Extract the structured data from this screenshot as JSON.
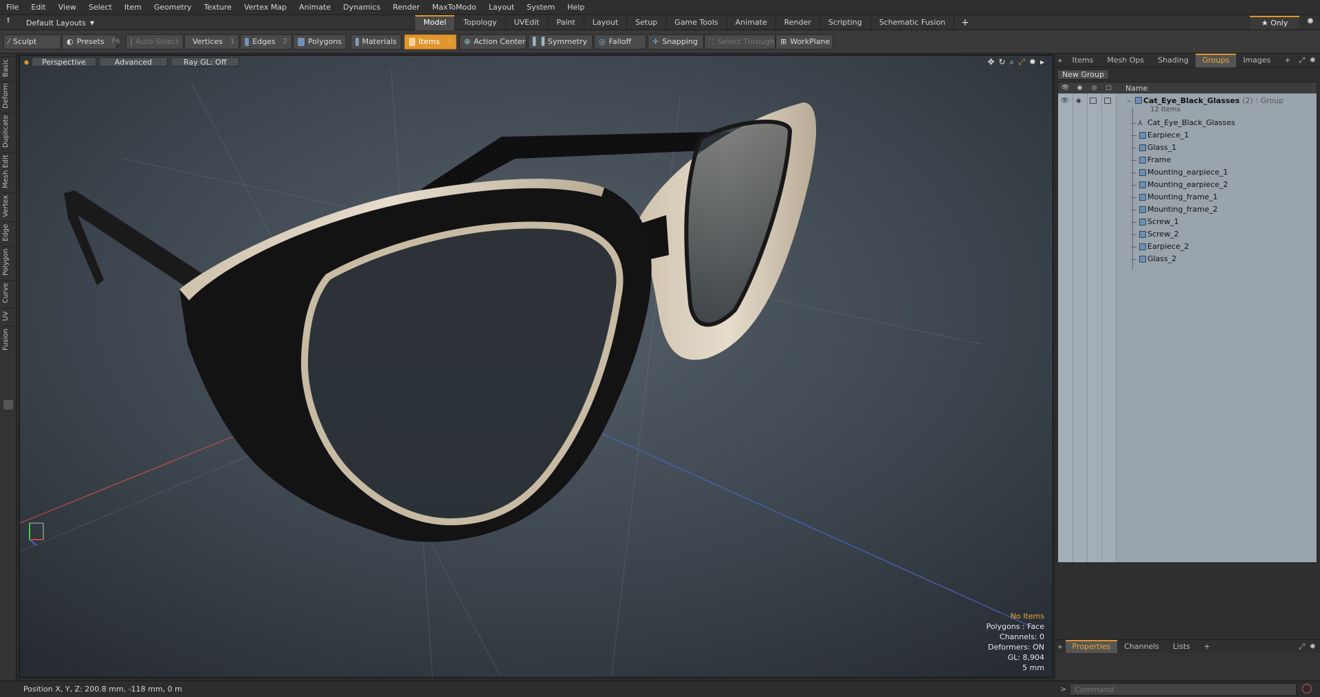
{
  "menu": [
    "File",
    "Edit",
    "View",
    "Select",
    "Item",
    "Geometry",
    "Texture",
    "Vertex Map",
    "Animate",
    "Dynamics",
    "Render",
    "MaxToModo",
    "Layout",
    "System",
    "Help"
  ],
  "layout_selector": "Default Layouts",
  "tabs": [
    {
      "label": "Model",
      "active": true
    },
    {
      "label": "Topology"
    },
    {
      "label": "UVEdit"
    },
    {
      "label": "Paint"
    },
    {
      "label": "Layout"
    },
    {
      "label": "Setup"
    },
    {
      "label": "Game Tools"
    },
    {
      "label": "Animate"
    },
    {
      "label": "Render"
    },
    {
      "label": "Scripting"
    },
    {
      "label": "Schematic Fusion"
    }
  ],
  "tab_plus": "+",
  "only_label": "★  Only",
  "toolbar": {
    "sculpt": "Sculpt",
    "presets": "Presets",
    "presets_key": "F6",
    "auto_select": "Auto Select",
    "vertices": "Vertices",
    "vertices_key": "1",
    "edges": "Edges",
    "edges_key": "2",
    "polygons": "Polygons",
    "materials": "Materials",
    "items": "Items",
    "items_key": "5",
    "action_center": "Action Center",
    "symmetry": "Symmetry",
    "falloff": "Falloff",
    "snapping": "Snapping",
    "select_through": "Select Through",
    "workplane": "WorkPlane"
  },
  "left_tabs": [
    "Basic",
    "Deform",
    "Duplicate",
    "Mesh Edit",
    "Vertex",
    "Edge",
    "Polygon",
    "Curve",
    "UV",
    "Fusion"
  ],
  "viewport": {
    "view": "Perspective",
    "advanced": "Advanced",
    "raygl": "Ray GL: Off",
    "info": {
      "no_items": "No Items",
      "polygons": "Polygons : Face",
      "channels": "Channels: 0",
      "deformers": "Deformers: ON",
      "gl": "GL: 8,904",
      "scale": "5 mm"
    }
  },
  "status": {
    "position": "Position X, Y, Z:   200.8 mm, -118 mm, 0 m",
    "command_placeholder": "Command"
  },
  "right_tabs": [
    {
      "label": "Items"
    },
    {
      "label": "Mesh Ops"
    },
    {
      "label": "Shading"
    },
    {
      "label": "Groups",
      "active": true
    },
    {
      "label": "Images"
    },
    {
      "label": "+"
    }
  ],
  "groups": {
    "new_group": "New Group",
    "name_col": "Name",
    "group_name": "Cat_Eye_Black_Glasses",
    "group_count": "(2)",
    "group_type": ": Group",
    "group_items": "12 Items",
    "items": [
      "Cat_Eye_Black_Glasses",
      "Earpiece_1",
      "Glass_1",
      "Frame",
      "Mounting_earpiece_1",
      "Mounting_earpiece_2",
      "Mounting_frame_1",
      "Mounting_frame_2",
      "Screw_1",
      "Screw_2",
      "Earpiece_2",
      "Glass_2"
    ]
  },
  "prop_tabs": [
    {
      "label": "Properties",
      "active": true
    },
    {
      "label": "Channels"
    },
    {
      "label": "Lists"
    },
    {
      "label": "+"
    }
  ],
  "colors": {
    "accent": "#e2962d",
    "tree_bg": "#9aa4ad",
    "frame": "#141414",
    "rim": "#d9cbb5"
  }
}
